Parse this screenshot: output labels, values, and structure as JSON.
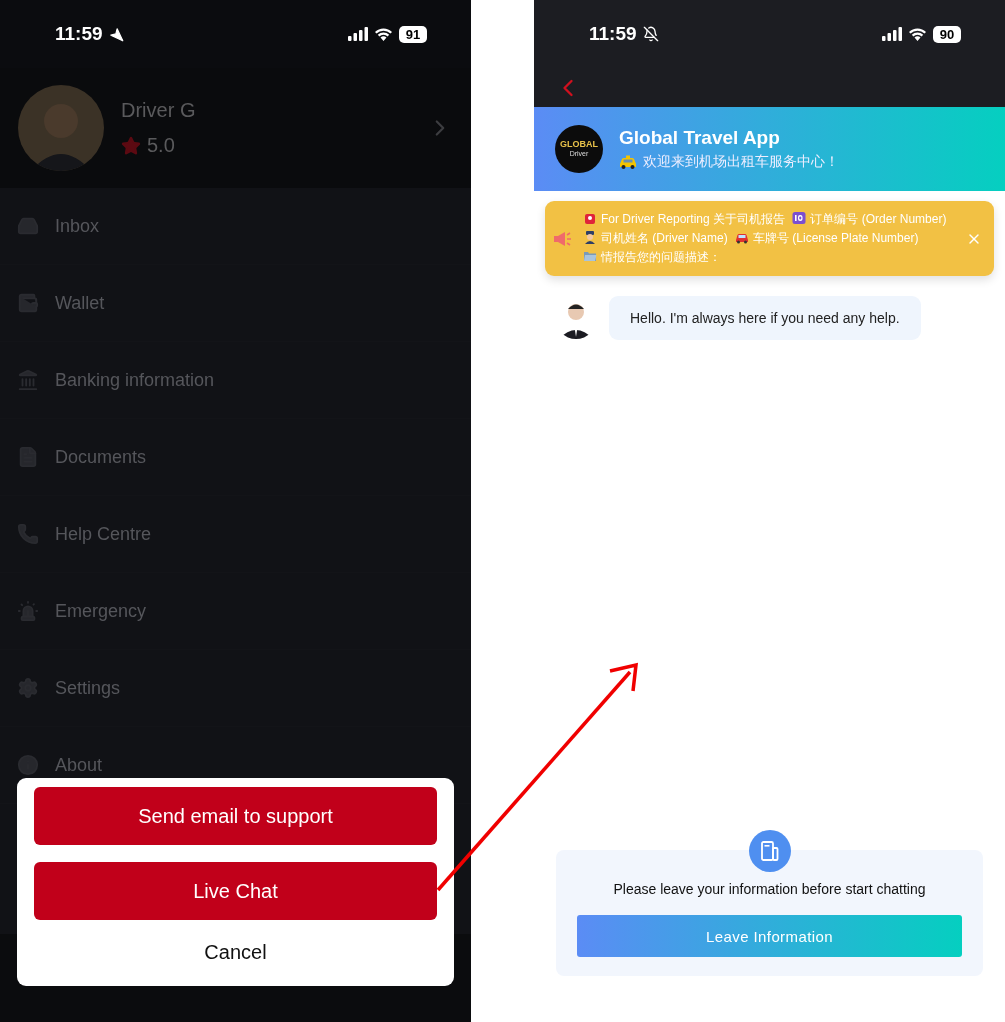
{
  "left_screen": {
    "status_bar": {
      "time": "11:59",
      "battery": "91"
    },
    "profile": {
      "name": "Driver G",
      "rating": "5.0"
    },
    "menu": [
      {
        "label": "Inbox"
      },
      {
        "label": "Wallet"
      },
      {
        "label": "Banking information"
      },
      {
        "label": "Documents"
      },
      {
        "label": "Help Centre"
      },
      {
        "label": "Emergency"
      },
      {
        "label": "Settings"
      },
      {
        "label": "About"
      }
    ],
    "action_sheet": {
      "buttons": [
        "Send email to support",
        "Live Chat"
      ],
      "cancel": "Cancel"
    }
  },
  "right_screen": {
    "status_bar": {
      "time": "11:59",
      "battery": "90"
    },
    "header": {
      "logo_text": "GLOBAL",
      "logo_subtext": "Driver",
      "title": "Global Travel App",
      "subtitle": "欢迎来到机场出租车服务中心！"
    },
    "notice": {
      "segments": [
        "For Driver Reporting 关于司机报告",
        "订单编号 (Order Number)",
        "司机姓名 (Driver Name)",
        "车牌号 (License Plate Number)",
        "情报告您的问题描述："
      ]
    },
    "messages": [
      {
        "text": "Hello. I'm always here if you need any help."
      }
    ],
    "info_card": {
      "prompt": "Please leave your information before start chatting",
      "button": "Leave Information"
    }
  }
}
